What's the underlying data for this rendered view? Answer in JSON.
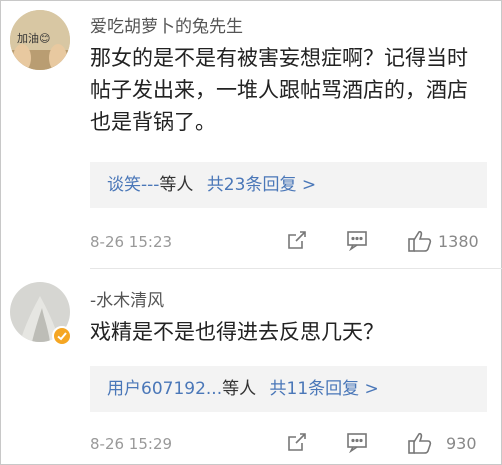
{
  "comments": [
    {
      "username": "爱吃胡萝卜的兔先生",
      "avatar_text": "加油😊",
      "content": "那女的是不是有被害妄想症啊？记得当时帖子发出来，一堆人跟帖骂酒店的，酒店也是背锅了。",
      "reply_users": "谈笑---",
      "reply_mid": "等人",
      "reply_count": "共23条回复 >",
      "time": "8-26 15:23",
      "likes": "1380"
    },
    {
      "username": "-水木清风",
      "content": "戏精是不是也得进去反思几天？",
      "reply_users": "用户607192...",
      "reply_mid": "等人",
      "reply_count": "共11条回复 >",
      "time": "8-26 15:29",
      "likes": "930"
    }
  ],
  "icons": {
    "share": "share-icon",
    "comment": "comment-icon",
    "like": "thumbs-up-icon",
    "verified": "verified-badge-icon"
  },
  "colors": {
    "link": "#4a77b8",
    "badge": "#f5a623"
  }
}
